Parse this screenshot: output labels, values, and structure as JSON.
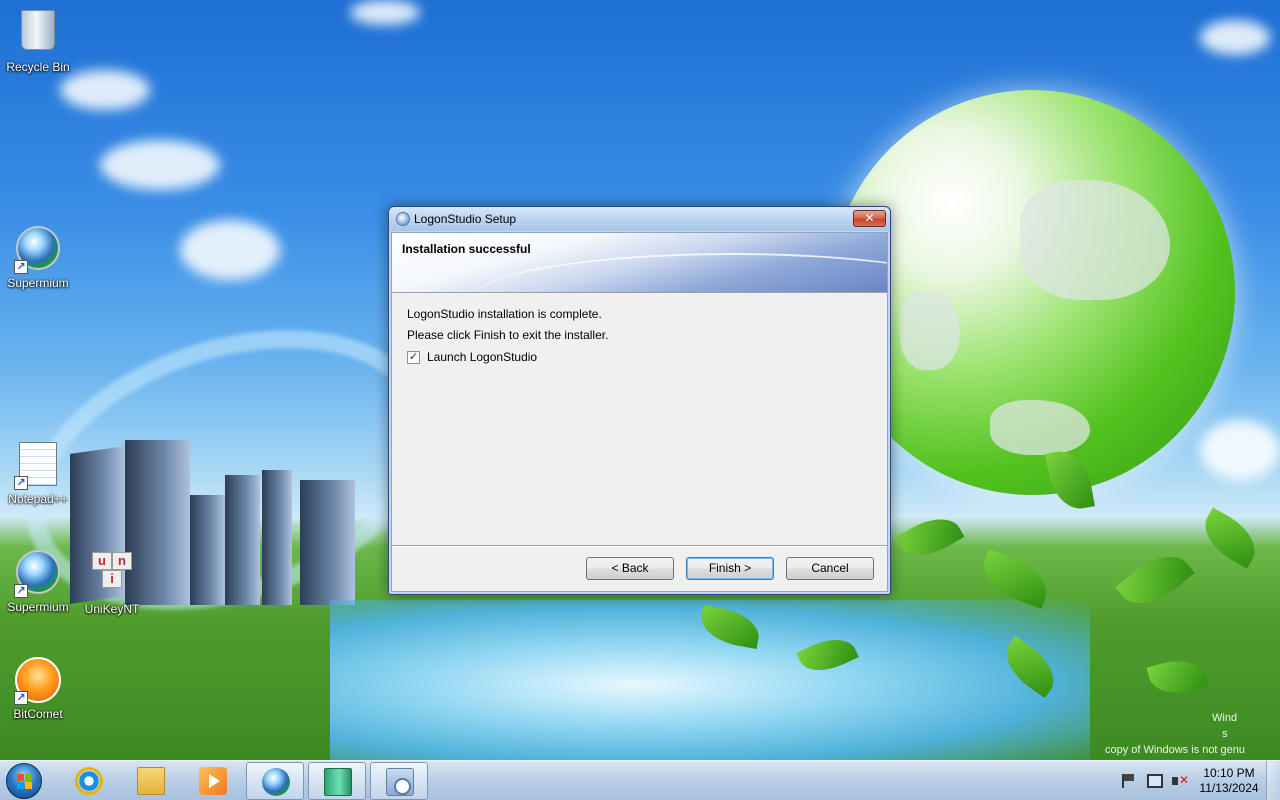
{
  "desktop": {
    "icons": [
      {
        "label": "Recycle Bin"
      },
      {
        "label": "Supermium"
      },
      {
        "label": "Notepad++"
      },
      {
        "label": "Supermium"
      },
      {
        "label": "UniKeyNT"
      },
      {
        "label": "BitComet"
      }
    ],
    "watermark_line1": "Wind",
    "watermark_line2": "s",
    "watermark_line3": "copy of Windows is not genu"
  },
  "dialog": {
    "title": "LogonStudio Setup",
    "close_label": "✕",
    "banner_title": "Installation successful",
    "line1": "LogonStudio installation is complete.",
    "line2": "Please click Finish to exit the installer.",
    "checkbox_label": "Launch LogonStudio",
    "checkbox_checked": true,
    "checkbox_mark": "✓",
    "buttons": {
      "back": "< Back",
      "finish": "Finish >",
      "cancel": "Cancel"
    }
  },
  "taskbar": {
    "pinned": [
      "internet-explorer-icon",
      "file-explorer-icon",
      "media-player-icon",
      "supermium-icon",
      "book-app-icon",
      "setup-installer-icon"
    ],
    "clock_time": "10:10 PM",
    "clock_date": "11/13/2024"
  }
}
